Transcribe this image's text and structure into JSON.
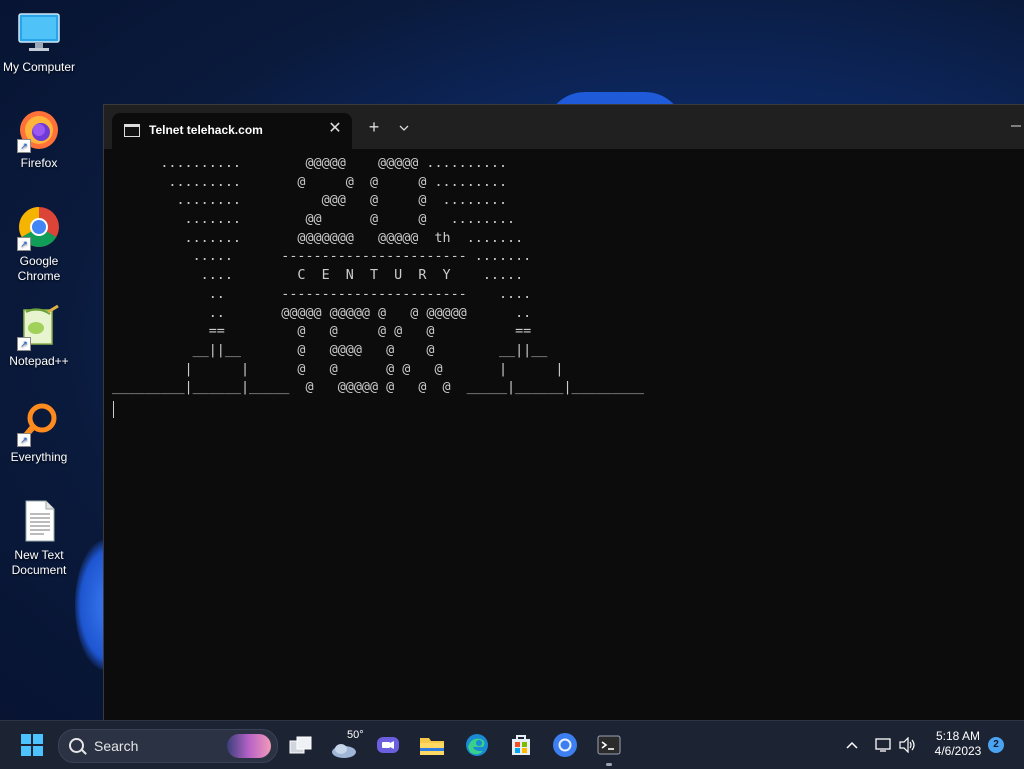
{
  "desktop": {
    "icons": [
      {
        "label_line1": "My Computer",
        "label_line2": ""
      },
      {
        "label_line1": "Firefox",
        "label_line2": ""
      },
      {
        "label_line1": "Google",
        "label_line2": "Chrome"
      },
      {
        "label_line1": "Notepad++",
        "label_line2": ""
      },
      {
        "label_line1": "Everything",
        "label_line2": ""
      },
      {
        "label_line1": "New Text",
        "label_line2": "Document"
      }
    ]
  },
  "terminal": {
    "tab_title": "Telnet telehack.com",
    "new_tab_glyph": "+",
    "close_glyph": "✕",
    "lines": [
      "      ..........        @@@@@    @@@@@ ..........",
      "       .........       @     @  @     @ .........",
      "        ........          @@@   @     @  ........",
      "         .......        @@      @     @   ........",
      "         .......       @@@@@@@   @@@@@  th  .......",
      "          .....      ----------------------- .......",
      "           ....        C  E  N  T  U  R  Y    .....",
      "            ..       -----------------------    ....",
      "            ..       @@@@@ @@@@@ @   @ @@@@@      ..",
      "            ==         @   @     @ @   @          ==",
      "          __||__       @   @@@@   @    @        __||__",
      "         |      |      @   @      @ @   @       |      |",
      "_________|______|_____  @   @@@@@ @   @  @  _____|______|_________"
    ]
  },
  "taskbar": {
    "search_label": "Search",
    "weather_temp": "50°",
    "time": "5:18 AM",
    "date": "4/6/2023",
    "notification_count": "2"
  },
  "colors": {
    "start_accent": "#4cc2ff",
    "terminal_bg": "#0c0c0c",
    "terminal_fg": "#cccccc"
  }
}
